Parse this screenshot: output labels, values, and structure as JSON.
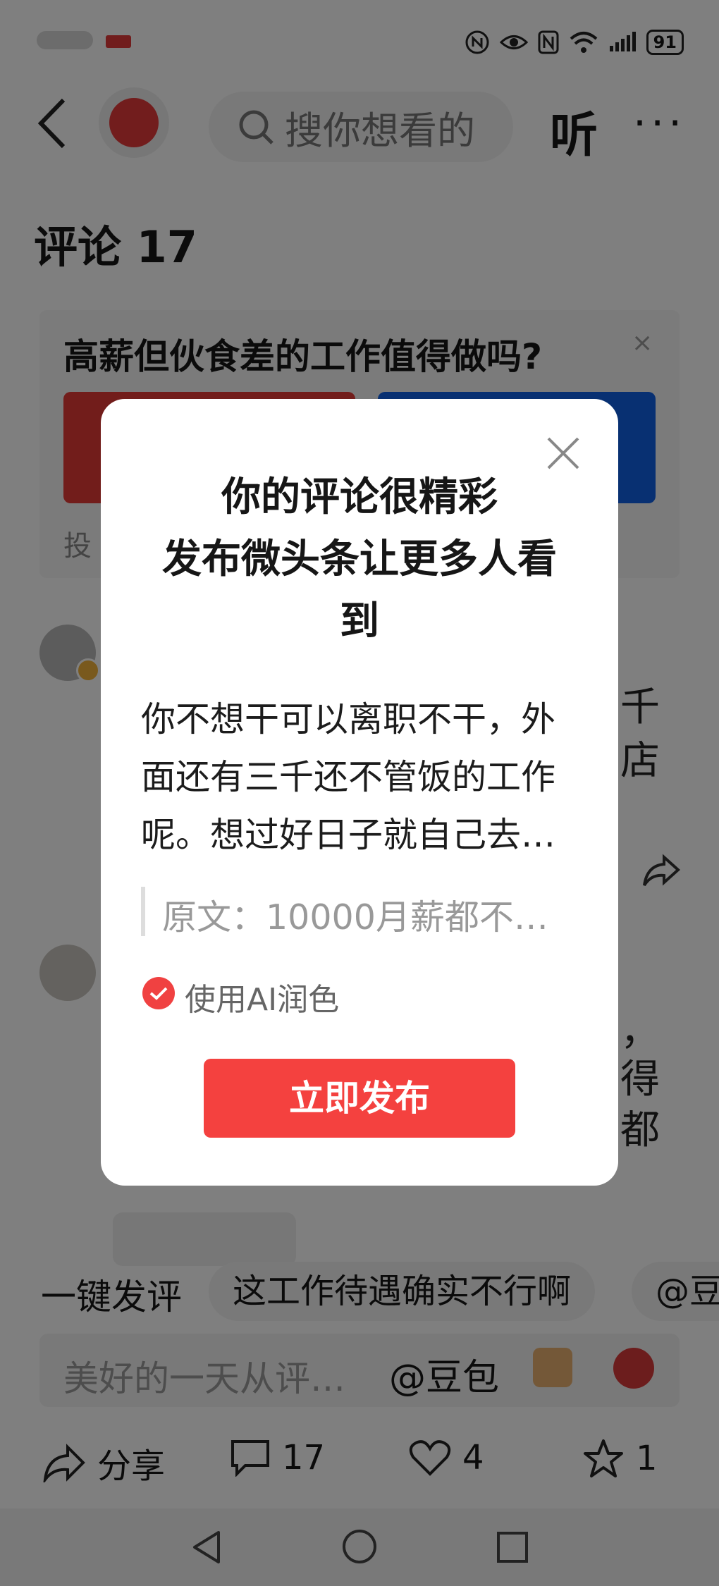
{
  "status": {
    "battery": "91"
  },
  "header": {
    "search_placeholder": "搜你想看的",
    "listen_label": "听",
    "more_label": "···"
  },
  "comments_header": {
    "title": "评论 17"
  },
  "poll": {
    "question": "高薪但伙食差的工作值得做吗?",
    "close": "×",
    "note": "投"
  },
  "background_comments": {
    "frag1": "千",
    "frag2": "店",
    "frag3": "，",
    "frag4": "得",
    "frag5": "都"
  },
  "quick_comment": {
    "label": "一键发评",
    "chips": [
      "这工作待遇确实不行啊",
      "@豆"
    ]
  },
  "input": {
    "placeholder": "美好的一天从评…",
    "mention": "@豆包"
  },
  "actions": {
    "share": "分享",
    "comments": "17",
    "likes": "4",
    "favorites": "1"
  },
  "dialog": {
    "title_line1": "你的评论很精彩",
    "title_line2": "发布微头条让更多人看",
    "title_line3": "到",
    "body_line1": "你不想干可以离职不干，外",
    "body_line2": "面还有三千还不管饭的工作",
    "body_line3": "呢。想过好日子就自己去…",
    "original": "原文：10000月薪都不…",
    "ai_polish": "使用AI润色",
    "publish": "立即发布"
  },
  "colors": {
    "accent_red": "#f4413f",
    "poll_blue": "#1161e4"
  }
}
